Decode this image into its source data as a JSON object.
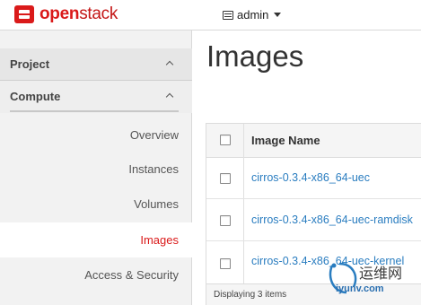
{
  "brand": {
    "name_bold": "open",
    "name_rest": "stack",
    "color": "#da1a1a"
  },
  "topbar": {
    "project_label": "admin",
    "project_icon": "project-icon",
    "dropdown_icon": "caret-down-icon"
  },
  "sidebar": {
    "sections": [
      {
        "label": "Project",
        "icon": "chevron-up-icon"
      },
      {
        "label": "Compute",
        "icon": "chevron-up-icon"
      }
    ],
    "items": [
      {
        "label": "Overview",
        "active": false
      },
      {
        "label": "Instances",
        "active": false
      },
      {
        "label": "Volumes",
        "active": false
      },
      {
        "label": "Images",
        "active": true
      },
      {
        "label": "Access & Security",
        "active": false
      }
    ]
  },
  "main": {
    "title": "Images",
    "table": {
      "columns": [
        "",
        "Image Name"
      ],
      "rows": [
        {
          "name": "cirros-0.3.4-x86_64-uec"
        },
        {
          "name": "cirros-0.3.4-x86_64-uec-ramdisk"
        },
        {
          "name": "cirros-0.3.4-x86_64-uec-kernel"
        }
      ],
      "footer": "Displaying 3 items"
    }
  },
  "watermark": {
    "line1": "运维网",
    "line2": "iyunv.com"
  },
  "colors": {
    "accent": "#da1a1a",
    "link": "#2a7dc0"
  }
}
